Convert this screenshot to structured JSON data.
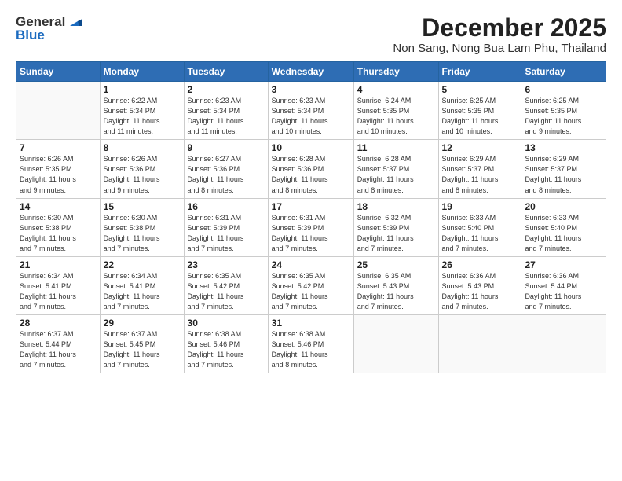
{
  "logo": {
    "general": "General",
    "blue": "Blue"
  },
  "title": "December 2025",
  "location": "Non Sang, Nong Bua Lam Phu, Thailand",
  "days_of_week": [
    "Sunday",
    "Monday",
    "Tuesday",
    "Wednesday",
    "Thursday",
    "Friday",
    "Saturday"
  ],
  "weeks": [
    [
      {
        "day": "",
        "info": ""
      },
      {
        "day": "1",
        "info": "Sunrise: 6:22 AM\nSunset: 5:34 PM\nDaylight: 11 hours\nand 11 minutes."
      },
      {
        "day": "2",
        "info": "Sunrise: 6:23 AM\nSunset: 5:34 PM\nDaylight: 11 hours\nand 11 minutes."
      },
      {
        "day": "3",
        "info": "Sunrise: 6:23 AM\nSunset: 5:34 PM\nDaylight: 11 hours\nand 10 minutes."
      },
      {
        "day": "4",
        "info": "Sunrise: 6:24 AM\nSunset: 5:35 PM\nDaylight: 11 hours\nand 10 minutes."
      },
      {
        "day": "5",
        "info": "Sunrise: 6:25 AM\nSunset: 5:35 PM\nDaylight: 11 hours\nand 10 minutes."
      },
      {
        "day": "6",
        "info": "Sunrise: 6:25 AM\nSunset: 5:35 PM\nDaylight: 11 hours\nand 9 minutes."
      }
    ],
    [
      {
        "day": "7",
        "info": "Sunrise: 6:26 AM\nSunset: 5:35 PM\nDaylight: 11 hours\nand 9 minutes."
      },
      {
        "day": "8",
        "info": "Sunrise: 6:26 AM\nSunset: 5:36 PM\nDaylight: 11 hours\nand 9 minutes."
      },
      {
        "day": "9",
        "info": "Sunrise: 6:27 AM\nSunset: 5:36 PM\nDaylight: 11 hours\nand 8 minutes."
      },
      {
        "day": "10",
        "info": "Sunrise: 6:28 AM\nSunset: 5:36 PM\nDaylight: 11 hours\nand 8 minutes."
      },
      {
        "day": "11",
        "info": "Sunrise: 6:28 AM\nSunset: 5:37 PM\nDaylight: 11 hours\nand 8 minutes."
      },
      {
        "day": "12",
        "info": "Sunrise: 6:29 AM\nSunset: 5:37 PM\nDaylight: 11 hours\nand 8 minutes."
      },
      {
        "day": "13",
        "info": "Sunrise: 6:29 AM\nSunset: 5:37 PM\nDaylight: 11 hours\nand 8 minutes."
      }
    ],
    [
      {
        "day": "14",
        "info": "Sunrise: 6:30 AM\nSunset: 5:38 PM\nDaylight: 11 hours\nand 7 minutes."
      },
      {
        "day": "15",
        "info": "Sunrise: 6:30 AM\nSunset: 5:38 PM\nDaylight: 11 hours\nand 7 minutes."
      },
      {
        "day": "16",
        "info": "Sunrise: 6:31 AM\nSunset: 5:39 PM\nDaylight: 11 hours\nand 7 minutes."
      },
      {
        "day": "17",
        "info": "Sunrise: 6:31 AM\nSunset: 5:39 PM\nDaylight: 11 hours\nand 7 minutes."
      },
      {
        "day": "18",
        "info": "Sunrise: 6:32 AM\nSunset: 5:39 PM\nDaylight: 11 hours\nand 7 minutes."
      },
      {
        "day": "19",
        "info": "Sunrise: 6:33 AM\nSunset: 5:40 PM\nDaylight: 11 hours\nand 7 minutes."
      },
      {
        "day": "20",
        "info": "Sunrise: 6:33 AM\nSunset: 5:40 PM\nDaylight: 11 hours\nand 7 minutes."
      }
    ],
    [
      {
        "day": "21",
        "info": "Sunrise: 6:34 AM\nSunset: 5:41 PM\nDaylight: 11 hours\nand 7 minutes."
      },
      {
        "day": "22",
        "info": "Sunrise: 6:34 AM\nSunset: 5:41 PM\nDaylight: 11 hours\nand 7 minutes."
      },
      {
        "day": "23",
        "info": "Sunrise: 6:35 AM\nSunset: 5:42 PM\nDaylight: 11 hours\nand 7 minutes."
      },
      {
        "day": "24",
        "info": "Sunrise: 6:35 AM\nSunset: 5:42 PM\nDaylight: 11 hours\nand 7 minutes."
      },
      {
        "day": "25",
        "info": "Sunrise: 6:35 AM\nSunset: 5:43 PM\nDaylight: 11 hours\nand 7 minutes."
      },
      {
        "day": "26",
        "info": "Sunrise: 6:36 AM\nSunset: 5:43 PM\nDaylight: 11 hours\nand 7 minutes."
      },
      {
        "day": "27",
        "info": "Sunrise: 6:36 AM\nSunset: 5:44 PM\nDaylight: 11 hours\nand 7 minutes."
      }
    ],
    [
      {
        "day": "28",
        "info": "Sunrise: 6:37 AM\nSunset: 5:44 PM\nDaylight: 11 hours\nand 7 minutes."
      },
      {
        "day": "29",
        "info": "Sunrise: 6:37 AM\nSunset: 5:45 PM\nDaylight: 11 hours\nand 7 minutes."
      },
      {
        "day": "30",
        "info": "Sunrise: 6:38 AM\nSunset: 5:46 PM\nDaylight: 11 hours\nand 7 minutes."
      },
      {
        "day": "31",
        "info": "Sunrise: 6:38 AM\nSunset: 5:46 PM\nDaylight: 11 hours\nand 8 minutes."
      },
      {
        "day": "",
        "info": ""
      },
      {
        "day": "",
        "info": ""
      },
      {
        "day": "",
        "info": ""
      }
    ]
  ]
}
